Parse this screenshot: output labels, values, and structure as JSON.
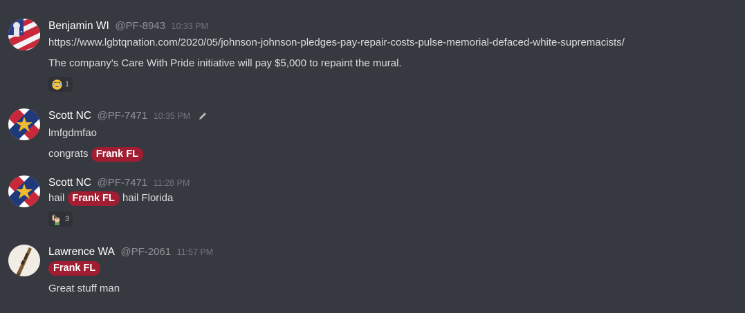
{
  "messages": [
    {
      "username": "Benjamin WI",
      "handle": "@PF-8943",
      "time": "10:33 PM",
      "link": "https://www.lgbtqnation.com/2020/05/johnson-johnson-pledges-pay-repair-costs-pulse-memorial-defaced-white-supremacists/",
      "text": "The company's Care With Pride initiative will pay $5,000 to repaint the mural.",
      "reaction": {
        "icon": "joy-emoji",
        "count": "1"
      }
    },
    {
      "username": "Scott NC",
      "handle": "@PF-7471",
      "time": "10:35 PM",
      "edited_icon": "pencil-icon",
      "line1": "lmfgdmfao",
      "line2_prefix": "congrats",
      "line2_mention": "Frank FL"
    },
    {
      "username": "Scott NC",
      "handle": "@PF-7471",
      "time": "11:28 PM",
      "prefix": "hail",
      "mention": "Frank FL",
      "suffix": "hail Florida",
      "reaction": {
        "icon": "raised-hand-emoji",
        "count": "3"
      }
    },
    {
      "username": "Lawrence WA",
      "handle": "@PF-2061",
      "time": "11:57 PM",
      "mention": "Frank FL",
      "text": "Great stuff man"
    }
  ],
  "colors": {
    "background": "#36393f",
    "mention_background": "#a01d32",
    "username": "#ffffff",
    "text": "#dcddde",
    "timestamp": "#72767d"
  }
}
